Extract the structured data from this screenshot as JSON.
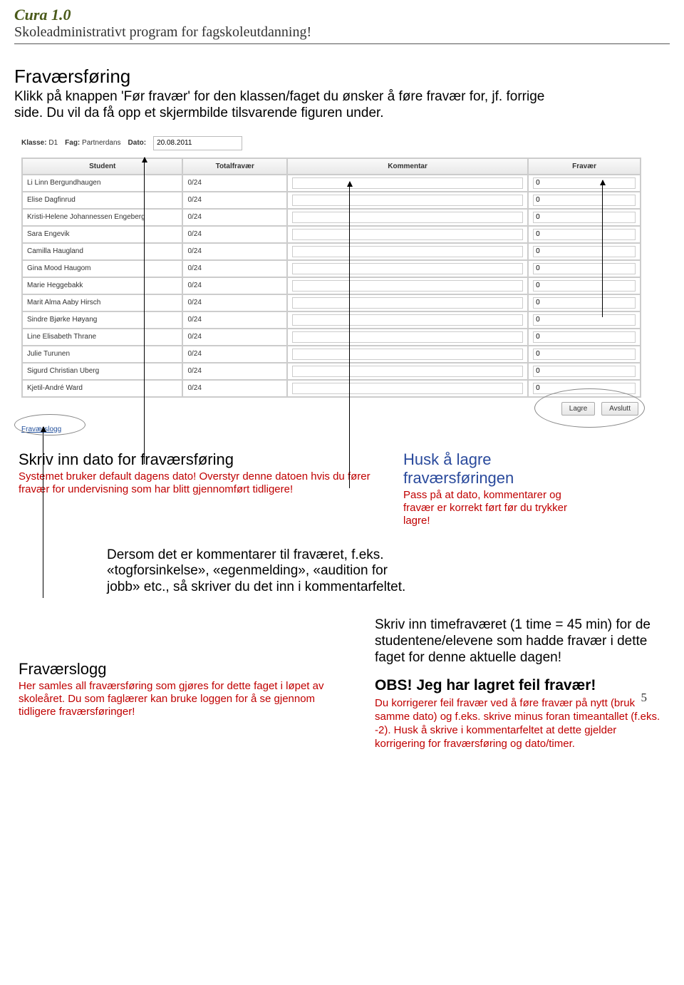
{
  "header": {
    "title": "Cura 1.0",
    "subtitle": "Skoleadministrativt program for fagskoleutdanning!"
  },
  "section_title": "Fraværsføring",
  "intro": "Klikk på knappen 'Før fravær' for den klassen/faget du ønsker å føre fravær for, jf. forrige side. Du vil da få opp et skjermbilde tilsvarende figuren under.",
  "app": {
    "klasse_label": "Klasse:",
    "klasse_value": "D1",
    "fag_label": "Fag:",
    "fag_value": "Partnerdans",
    "dato_label": "Dato:",
    "dato_value": "20.08.2011",
    "headers": {
      "student": "Student",
      "total": "Totalfravær",
      "kommentar": "Kommentar",
      "fravar": "Fravær"
    },
    "rows": [
      {
        "student": "Li Linn Bergundhaugen",
        "total": "0/24",
        "kommentar": "",
        "fravar": "0"
      },
      {
        "student": "Elise Dagfinrud",
        "total": "0/24",
        "kommentar": "",
        "fravar": "0"
      },
      {
        "student": "Kristi-Helene Johannessen Engeberg",
        "total": "0/24",
        "kommentar": "",
        "fravar": "0"
      },
      {
        "student": "Sara Engevik",
        "total": "0/24",
        "kommentar": "",
        "fravar": "0"
      },
      {
        "student": "Camilla Haugland",
        "total": "0/24",
        "kommentar": "",
        "fravar": "0"
      },
      {
        "student": "Gina Mood Haugom",
        "total": "0/24",
        "kommentar": "",
        "fravar": "0"
      },
      {
        "student": "Marie Heggebakk",
        "total": "0/24",
        "kommentar": "",
        "fravar": "0"
      },
      {
        "student": "Marit Alma Aaby Hirsch",
        "total": "0/24",
        "kommentar": "",
        "fravar": "0"
      },
      {
        "student": "Sindre Bjørke Høyang",
        "total": "0/24",
        "kommentar": "",
        "fravar": "0"
      },
      {
        "student": "Line Elisabeth Thrane",
        "total": "0/24",
        "kommentar": "",
        "fravar": "0"
      },
      {
        "student": "Julie Turunen",
        "total": "0/24",
        "kommentar": "",
        "fravar": "0"
      },
      {
        "student": "Sigurd Christian Uberg",
        "total": "0/24",
        "kommentar": "",
        "fravar": "0"
      },
      {
        "student": "Kjetil-André Ward",
        "total": "0/24",
        "kommentar": "",
        "fravar": "0"
      }
    ],
    "buttons": {
      "lagre": "Lagre",
      "avslutt": "Avslutt"
    },
    "logg_link": "Fraværslogg"
  },
  "anno": {
    "date_title": "Skriv inn dato for fraværsføring",
    "date_body": "Systemet bruker default dagens dato! Overstyr denne datoen hvis du fører fravær for undervisning som har blitt gjennomført tidligere!",
    "husk_title": "Husk å lagre fraværsføringen",
    "husk_body": "Pass på at dato, kommentarer og fravær er korrekt ført før du trykker lagre!",
    "center": "Dersom det er kommentarer til fraværet, f.eks. «togforsinkelse», «egenmelding», «audition for jobb» etc., så skriver du det inn i kommentarfeltet.",
    "logg_title": "Fraværslogg",
    "logg_body": "Her samles all fraværsføring som gjøres for dette faget i løpet av skoleåret. Du som faglærer kan bruke loggen for å se gjennom tidligere fraværsføringer!",
    "timefr": "Skriv inn timefraværet (1 time = 45 min) for de studentene/elevene som hadde fravær i dette faget for denne aktuelle dagen!",
    "obs_title": "OBS! Jeg har lagret feil fravær!",
    "obs_body": "Du korrigerer feil fravær ved å føre fravær på nytt (bruk samme dato) og f.eks. skrive minus foran timeantallet (f.eks. -2).  Husk å skrive i kommentarfeltet at dette gjelder korrigering for fraværsføring og dato/timer.",
    "page_num": "5"
  }
}
